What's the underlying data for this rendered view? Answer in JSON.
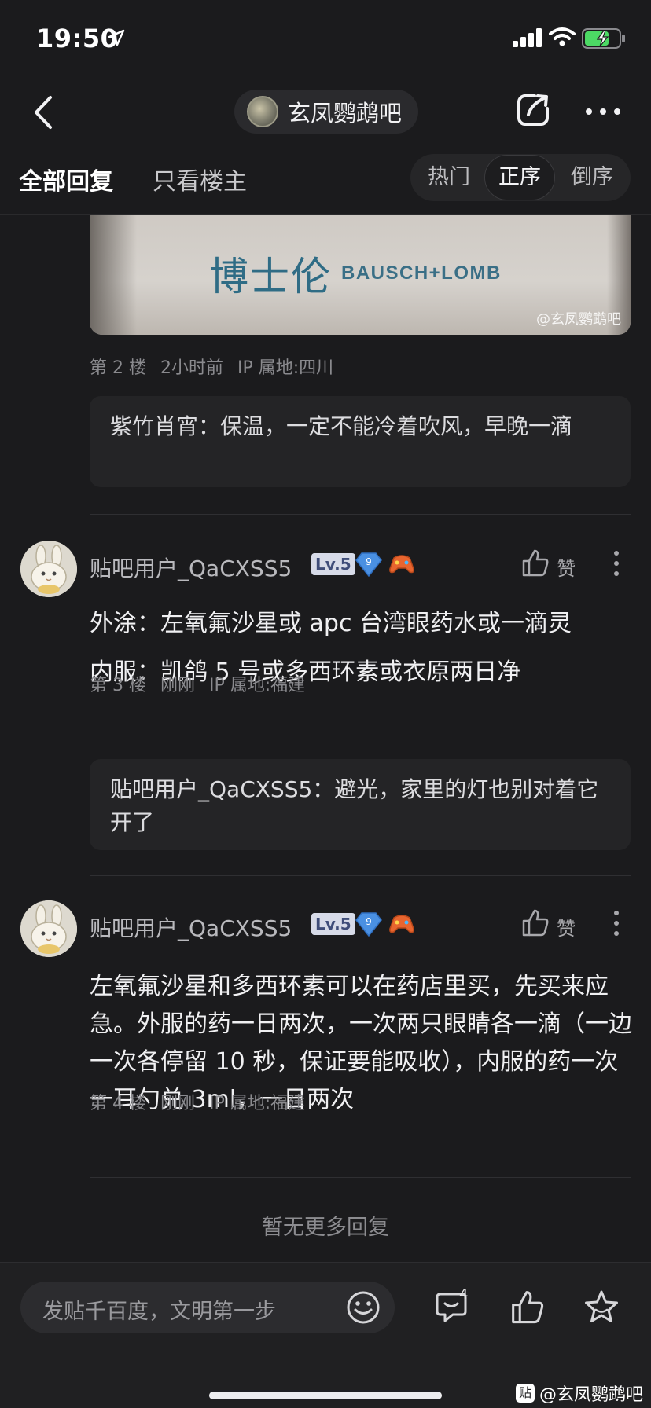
{
  "status_bar": {
    "time": "19:50"
  },
  "nav": {
    "forum_name": "玄凤鹦鹉吧"
  },
  "tabs": {
    "all_replies": "全部回复",
    "only_op": "只看楼主",
    "sort_hot": "热门",
    "sort_asc": "正序",
    "sort_desc": "倒序",
    "active_sort": "正序"
  },
  "photo": {
    "chinese_text": "博士伦",
    "english_text": "BAUSCH+LOMB",
    "watermark": "@玄凤鹦鹉吧"
  },
  "floor2": {
    "floor": "第 2 楼",
    "time": "2小时前",
    "ip": "IP 属地:四川",
    "sub_reply": {
      "author": "紫竹肖宵",
      "text": "：保温，一定不能冷着吹风，早晚一滴"
    }
  },
  "floor3": {
    "username": "贴吧用户_QaCXSS5",
    "level": "Lv.5",
    "badge_number": "9",
    "like_label": "赞",
    "lines": [
      "外涂：左氧氟沙星或 apc 台湾眼药水或一滴灵",
      "内服：凯鸽 5 号或多西环素或衣原两日净"
    ],
    "floor": "第 3 楼",
    "time": "刚刚",
    "ip": "IP 属地:福建",
    "sub_reply": {
      "author": "贴吧用户_QaCXSS5",
      "text": "：避光，家里的灯也别对着它开了"
    }
  },
  "floor4": {
    "username": "贴吧用户_QaCXSS5",
    "level": "Lv.5",
    "badge_number": "9",
    "like_label": "赞",
    "text": "左氧氟沙星和多西环素可以在药店里买，先买来应急。外服的药一日两次，一次两只眼睛各一滴（一边一次各停留 10 秒，保证要能吸收），内服的药一次一耳勺兑 3ml，一日两次",
    "floor": "第 4 楼",
    "time": "刚刚",
    "ip": "IP 属地:福建"
  },
  "no_more": "暂无更多回复",
  "bottom_bar": {
    "input_placeholder": "发贴千百度，文明第一步",
    "comment_count": "4",
    "watermark": "@玄凤鹦鹉吧",
    "watermark_logo": "贴"
  }
}
